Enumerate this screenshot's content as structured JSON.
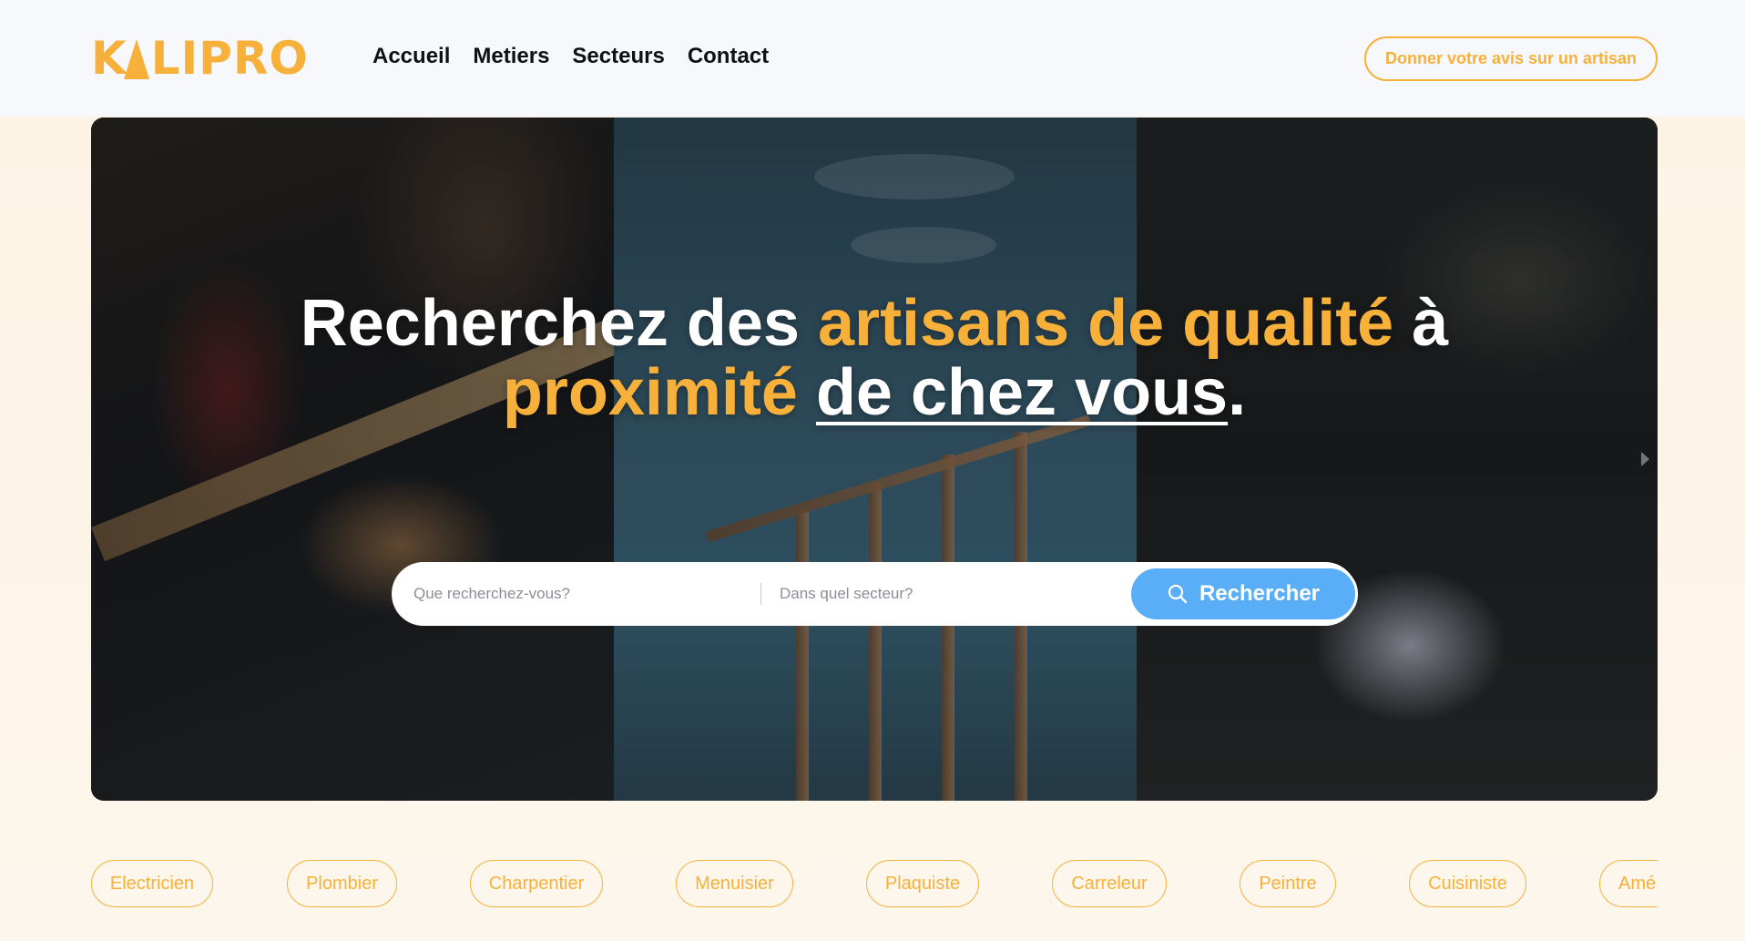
{
  "header": {
    "logo": "KALIPRO",
    "nav": [
      "Accueil",
      "Metiers",
      "Secteurs",
      "Contact"
    ],
    "cta_label": "Donner votre avis sur un artisan"
  },
  "hero": {
    "headline": {
      "part1": "Recherchez des ",
      "highlight1": "artisans de qualité",
      "part2": " à",
      "highlight2": "proximité",
      "part3": " ",
      "underlined": "de chez vous",
      "part4": "."
    },
    "search": {
      "what_placeholder": "Que recherchez-vous?",
      "where_placeholder": "Dans quel secteur?",
      "button_label": "Rechercher",
      "button_icon": "search-icon"
    }
  },
  "categories": [
    "Electricien",
    "Plombier",
    "Charpentier",
    "Menuisier",
    "Plaquiste",
    "Carreleur",
    "Peintre",
    "Cuisiniste",
    "Amé"
  ],
  "colors": {
    "accent": "#f7b13a",
    "button_blue": "#5aaef7",
    "header_bg": "#f6f8fb",
    "page_bg": "#fdf3e5"
  }
}
